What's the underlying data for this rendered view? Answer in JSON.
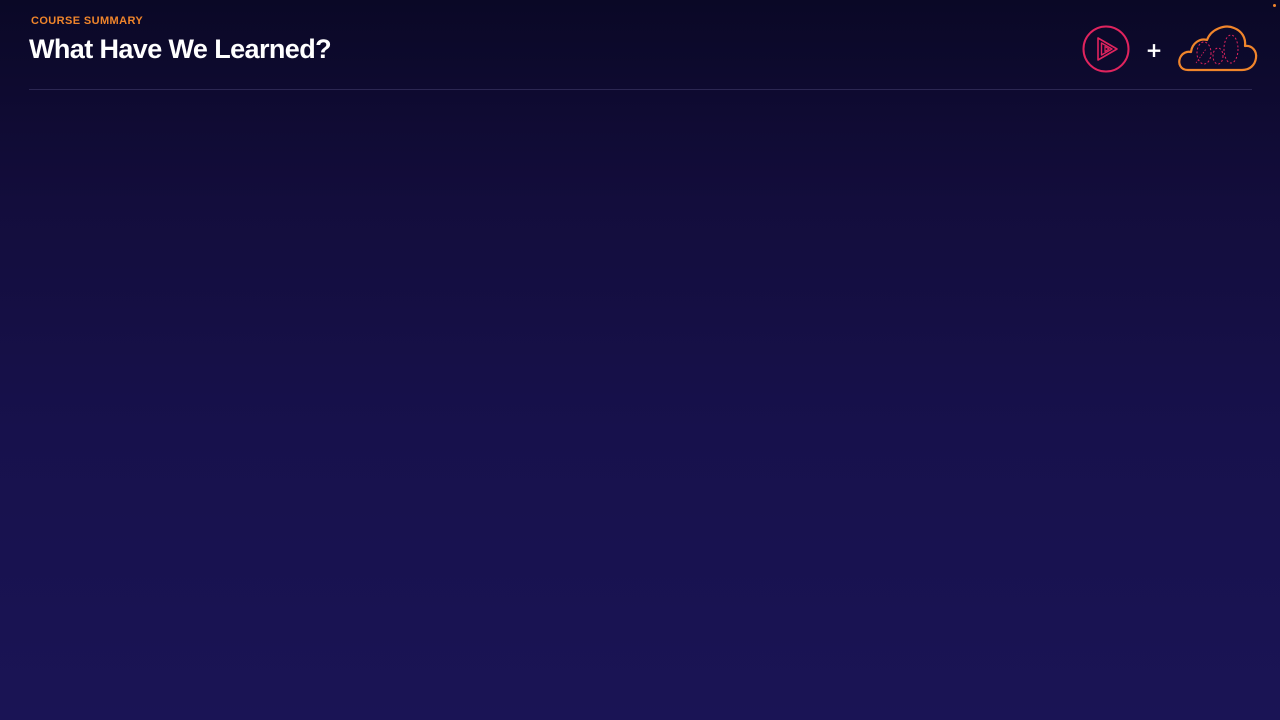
{
  "header": {
    "kicker": "COURSE SUMMARY",
    "title": "What Have We Learned?",
    "plus_symbol": "+"
  },
  "logos": {
    "left": "play-logo-icon",
    "right": "cloud-logo-icon"
  },
  "colors": {
    "background_top": "#0a0826",
    "background_bottom": "#1a1455",
    "kicker": "#f0852b",
    "title": "#ffffff",
    "play_logo": "#e0245e",
    "cloud_logo": "#f0852b",
    "divider": "#2c2752"
  }
}
